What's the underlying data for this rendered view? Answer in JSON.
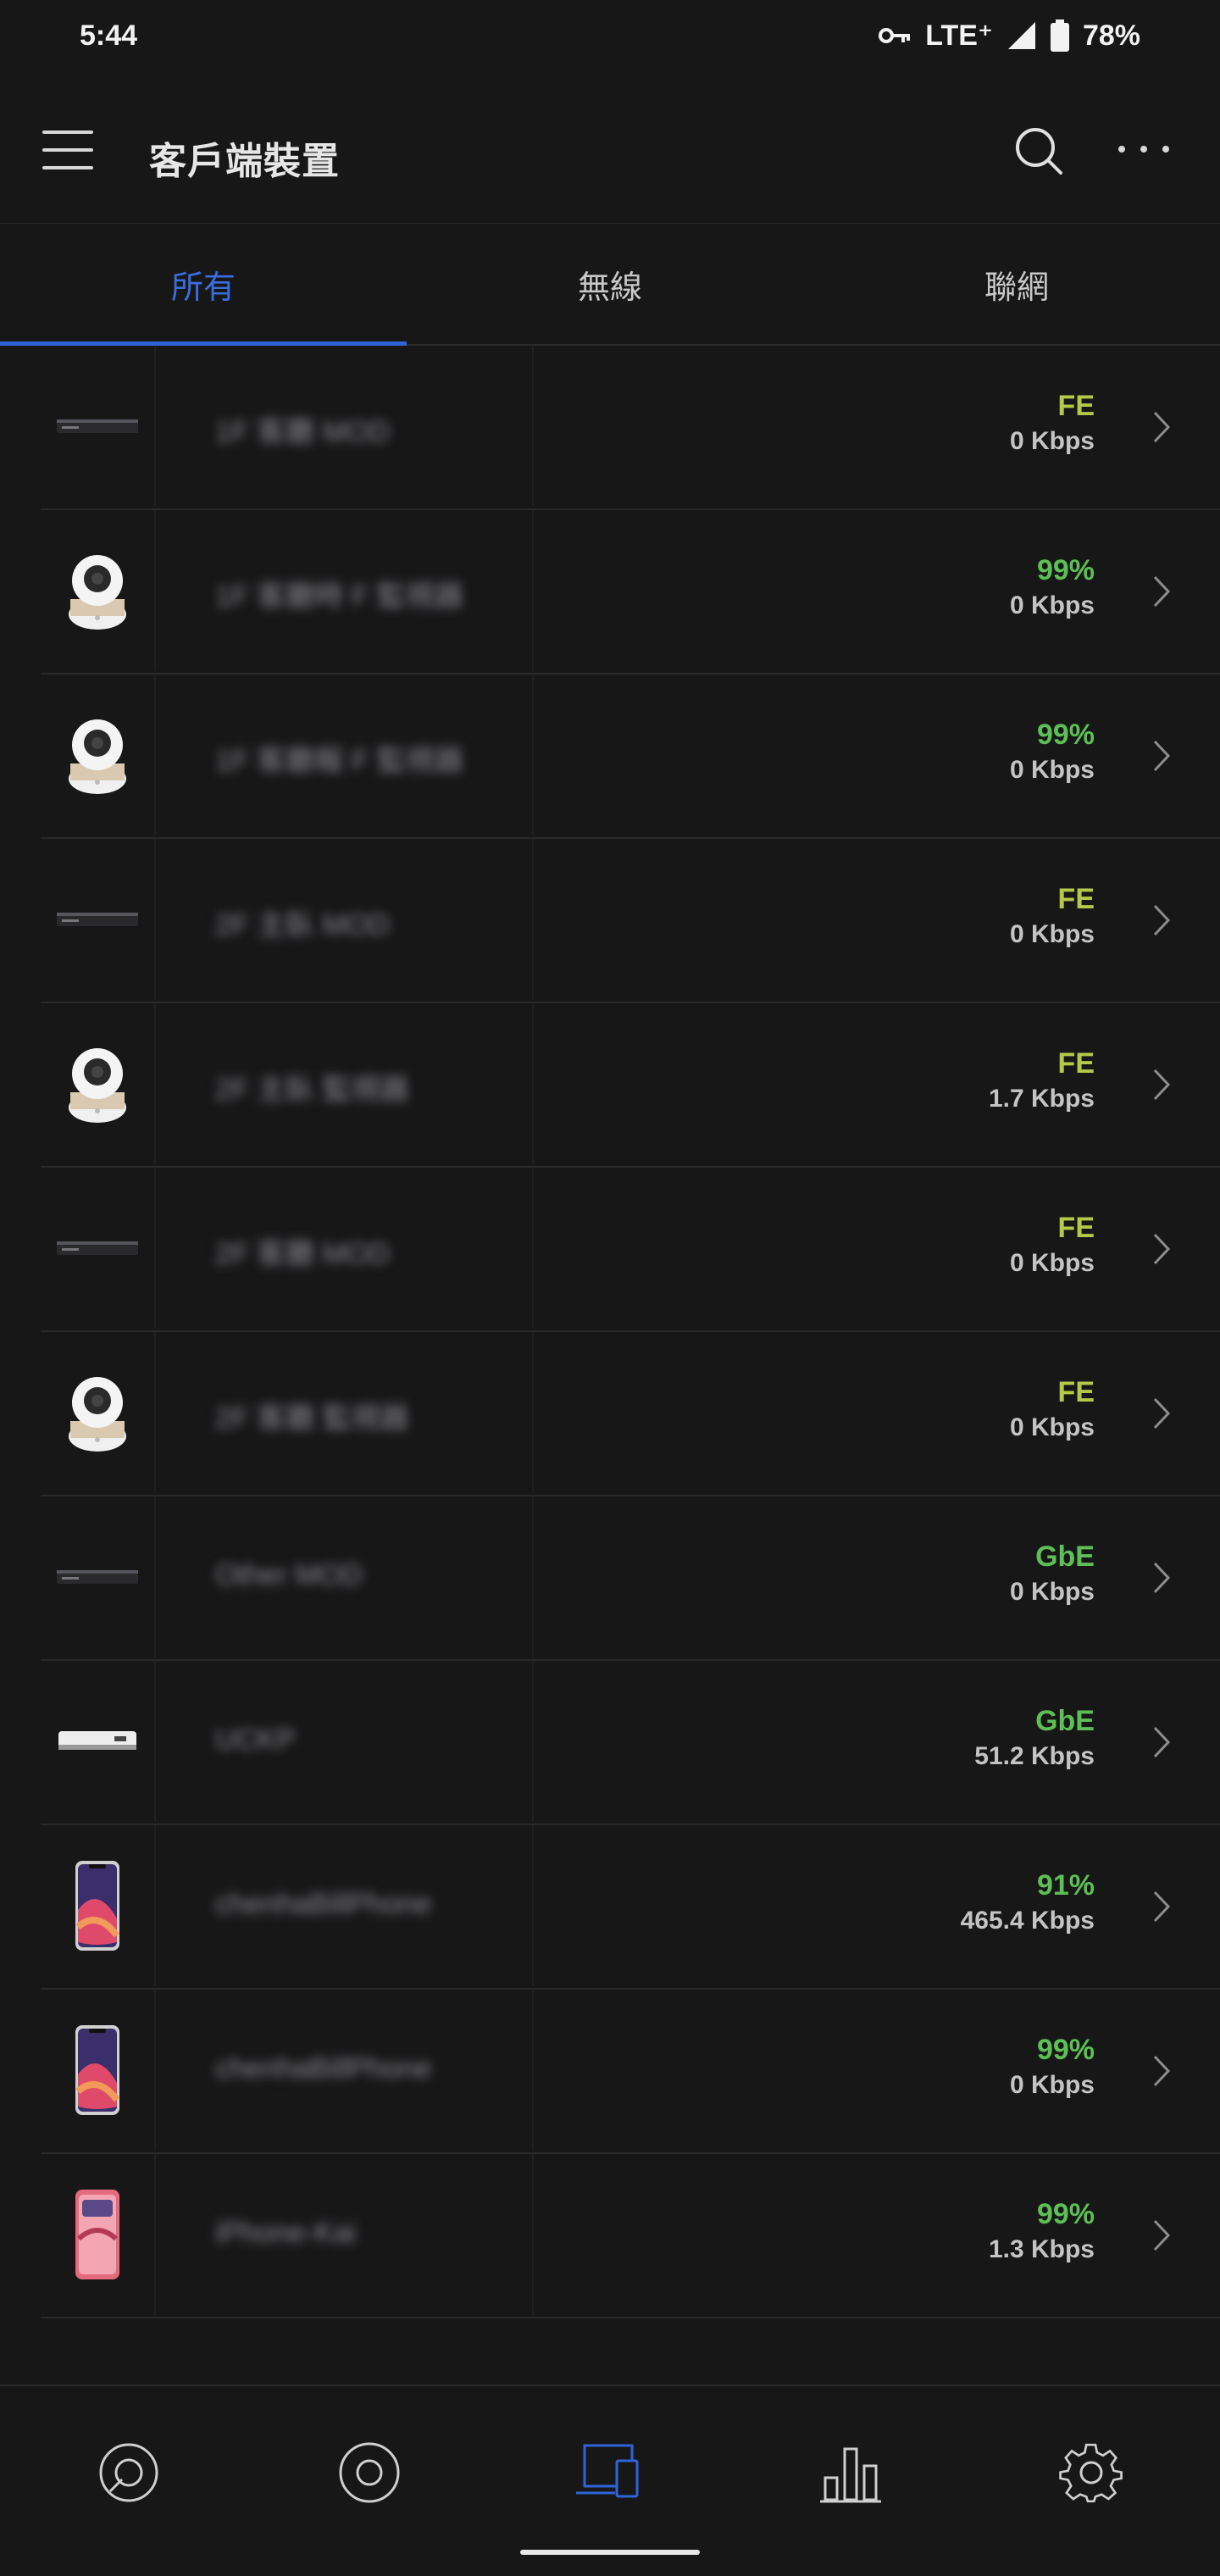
{
  "status_bar": {
    "time": "5:44",
    "network": "LTE⁺",
    "battery": "78%"
  },
  "app_bar": {
    "title": "客戶端裝置",
    "menu_icon": "hamburger-menu-icon",
    "search_icon": "search-icon",
    "more_icon": "more-horizontal-icon"
  },
  "tabs": [
    {
      "label": "所有",
      "active": true
    },
    {
      "label": "無線",
      "active": false
    },
    {
      "label": "聯網",
      "active": false
    }
  ],
  "clients": [
    {
      "name": "1F 客廳 MOD",
      "device": "set-top-box",
      "link": "FE",
      "link_color": "#b5c848",
      "rate": "0 Kbps"
    },
    {
      "name": "1F 客廳時 F 監視器",
      "device": "camera",
      "link": "99%",
      "link_color": "#5dbf55",
      "rate": "0 Kbps"
    },
    {
      "name": "1F 客廳報 F 監視器",
      "device": "camera",
      "link": "99%",
      "link_color": "#5dbf55",
      "rate": "0 Kbps"
    },
    {
      "name": "2F 主臥 MOD",
      "device": "set-top-box",
      "link": "FE",
      "link_color": "#b5c848",
      "rate": "0 Kbps"
    },
    {
      "name": "2F 主臥 監視器",
      "device": "camera",
      "link": "FE",
      "link_color": "#b5c848",
      "rate": "1.7 Kbps"
    },
    {
      "name": "2F 客廳 MOD",
      "device": "set-top-box",
      "link": "FE",
      "link_color": "#b5c848",
      "rate": "0 Kbps"
    },
    {
      "name": "2F 客廳 監視器",
      "device": "camera",
      "link": "FE",
      "link_color": "#b5c848",
      "rate": "0 Kbps"
    },
    {
      "name": "Other MOD",
      "device": "set-top-box",
      "link": "GbE",
      "link_color": "#5dbf55",
      "rate": "0 Kbps"
    },
    {
      "name": "UCKP",
      "device": "cloud-key",
      "link": "GbE",
      "link_color": "#5dbf55",
      "rate": "51.2 Kbps"
    },
    {
      "name": "chenhaBillPhone",
      "device": "iphone-x",
      "link": "91%",
      "link_color": "#5dbf55",
      "rate": "465.4 Kbps"
    },
    {
      "name": "chenhaBillPhone",
      "device": "iphone-x",
      "link": "99%",
      "link_color": "#5dbf55",
      "rate": "0 Kbps"
    },
    {
      "name": "iPhone-Kai",
      "device": "iphone-11",
      "link": "99%",
      "link_color": "#5dbf55",
      "rate": "1.3 Kbps"
    }
  ],
  "bottom_nav": [
    {
      "name": "dashboard-icon",
      "active": false
    },
    {
      "name": "devices-icon",
      "active": false
    },
    {
      "name": "clients-icon",
      "active": true
    },
    {
      "name": "statistics-icon",
      "active": false
    },
    {
      "name": "settings-icon",
      "active": false
    }
  ],
  "colors": {
    "accent": "#2f64d8",
    "background": "#171718",
    "good": "#5dbf55",
    "fe": "#b5c848"
  }
}
